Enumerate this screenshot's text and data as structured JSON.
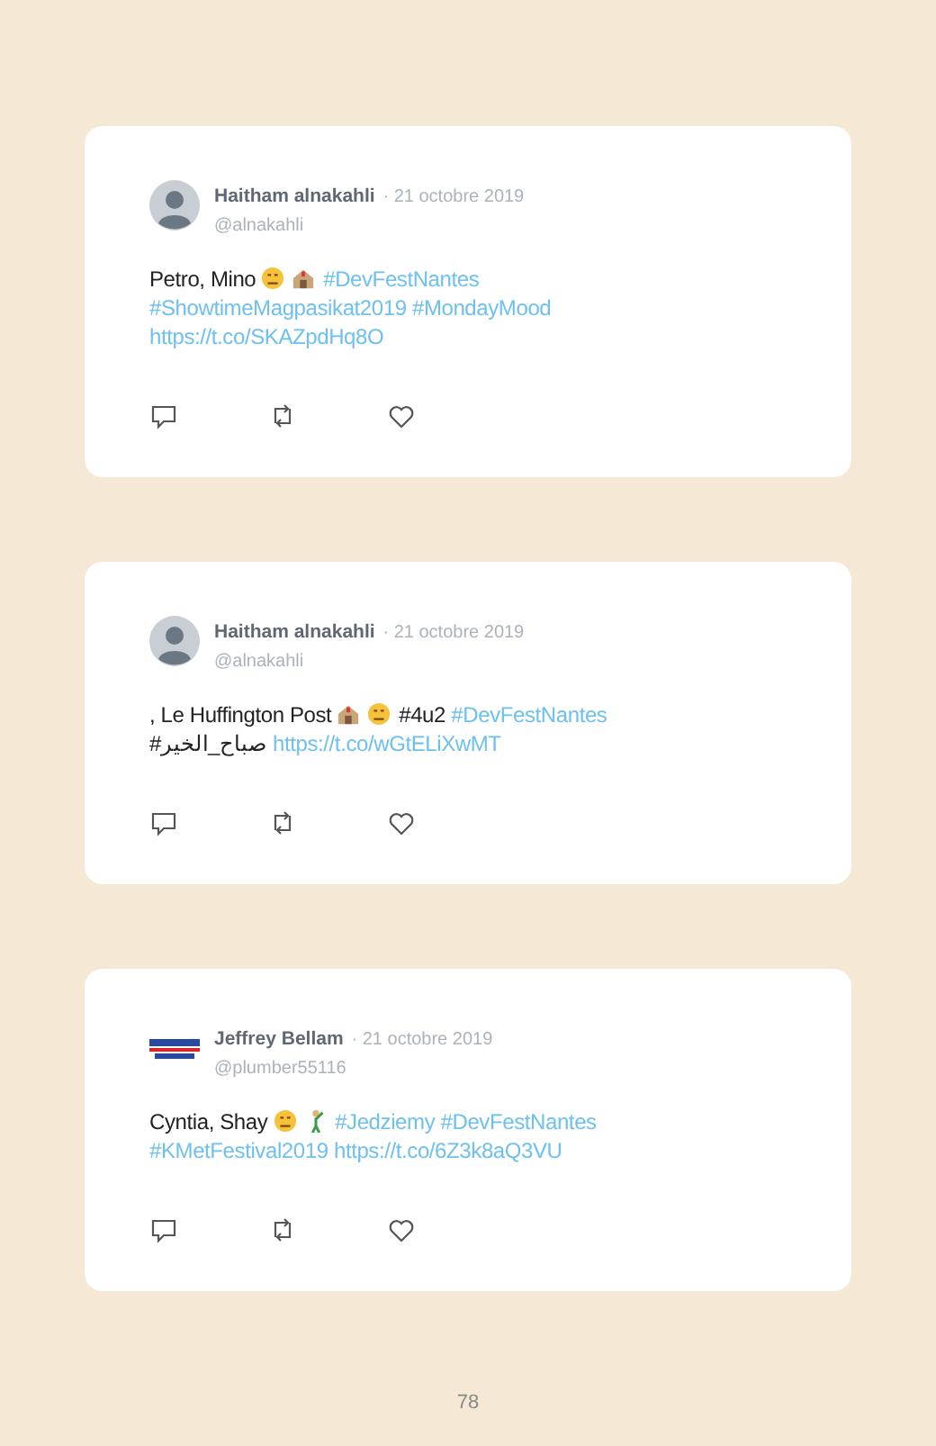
{
  "tweets": [
    {
      "author": "Haitham alnakahli",
      "date": "· 21 octobre 2019",
      "handle": "@alnakahli",
      "avatar": {
        "kind": "default"
      },
      "segments": [
        {
          "kind": "text",
          "text": "Petro, Mino"
        },
        {
          "kind": "face"
        },
        {
          "kind": "house"
        },
        {
          "kind": "link",
          "text": "#DevFestNantes"
        },
        {
          "kind": "link",
          "text": "#ShowtimeMagpasikat2019"
        },
        {
          "kind": "link",
          "text": "#MondayMood"
        },
        {
          "kind": "link",
          "text": "https://t.co/SKAZpdHq8O"
        }
      ]
    },
    {
      "author": "Haitham alnakahli",
      "date": "· 21 octobre 2019",
      "handle": "@alnakahli",
      "avatar": {
        "kind": "default"
      },
      "segments": [
        {
          "kind": "text",
          "text": ", Le Huffington Post"
        },
        {
          "kind": "house"
        },
        {
          "kind": "face"
        },
        {
          "kind": "text",
          "text": "#4u2"
        },
        {
          "kind": "link",
          "text": "#DevFestNantes"
        },
        {
          "kind": "text",
          "text": "#صباح_الخير"
        },
        {
          "kind": "link",
          "text": "https://t.co/wGtELiXwMT"
        }
      ]
    },
    {
      "author": "Jeffrey Bellam",
      "date": "· 21 octobre 2019",
      "handle": "@plumber55116",
      "avatar": {
        "kind": "logo"
      },
      "segments": [
        {
          "kind": "text",
          "text": "Cyntia, Shay"
        },
        {
          "kind": "face"
        },
        {
          "kind": "figure"
        },
        {
          "kind": "link",
          "text": "#Jedziemy"
        },
        {
          "kind": "link",
          "text": "#DevFestNantes"
        },
        {
          "kind": "link",
          "text": "#KMetFestival2019"
        },
        {
          "kind": "link",
          "text": "https://t.co/6Z3k8aQ3VU"
        }
      ]
    }
  ],
  "page_number": "78"
}
